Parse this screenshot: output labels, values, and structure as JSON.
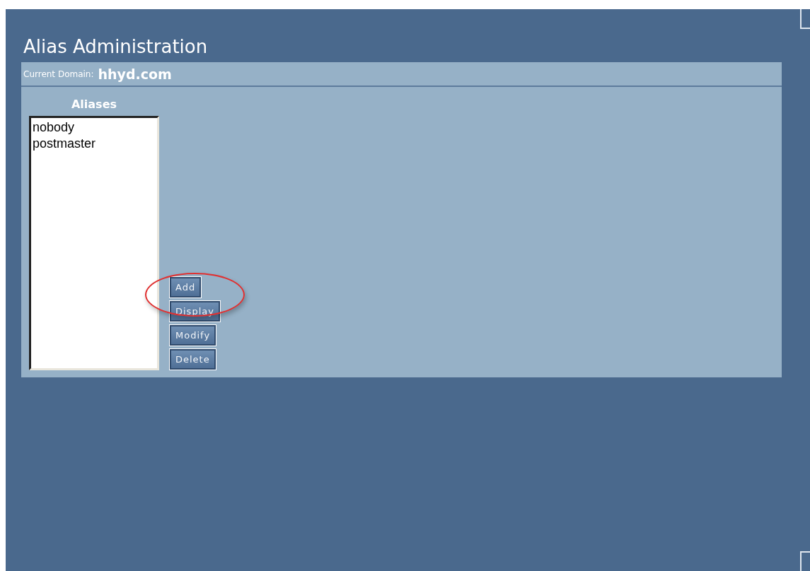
{
  "page": {
    "title": "Alias Administration"
  },
  "domain": {
    "label": "Current Domain:",
    "value": "hhyd.com"
  },
  "aliases": {
    "heading": "Aliases",
    "items": [
      "nobody",
      "postmaster"
    ]
  },
  "buttons": [
    "Add",
    "Display",
    "Modify",
    "Delete"
  ]
}
